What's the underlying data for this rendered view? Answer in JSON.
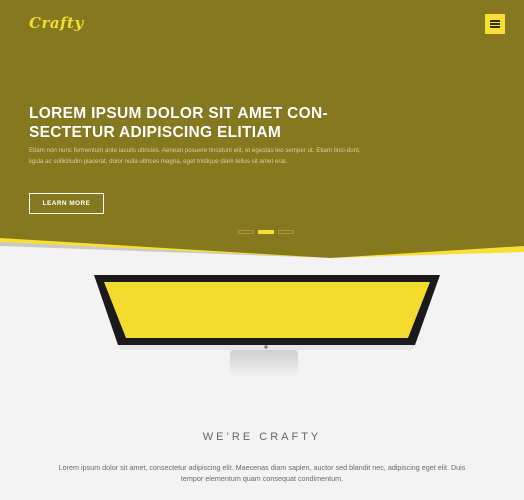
{
  "header": {
    "logo": "Crafty",
    "menu_icon": "hamburger-menu-icon"
  },
  "hero": {
    "title": "LOREM IPSUM DOLOR SIT AMET CON-SECTETUR ADIPISCING ELITIAM",
    "description": "Etiam non nunc fermentum ante iaculis ultricies. Aenean posuere tincidunt elit, et egestas leo semper ut. Etiam tinci-dunt, ligula ac sollicitudin placerat, dolor nulla ultrices magna, eget tristique diam tellus sit amet erat.",
    "cta_label": "LEARN MORE",
    "slide_count": 3,
    "active_slide": 2
  },
  "about": {
    "heading": "WE’RE  CRAFTY",
    "text": "Lorem ipsum dolor sit amet, consectetur adipiscing elit. Maecenas diam sapien, auctor sed blandit nec, adipiscing eget elit. Duis tempor elementum quam consequat condimentum."
  },
  "colors": {
    "hero_bg": "#85781f",
    "accent": "#f7e033",
    "page_bg": "#f3f3f3"
  }
}
